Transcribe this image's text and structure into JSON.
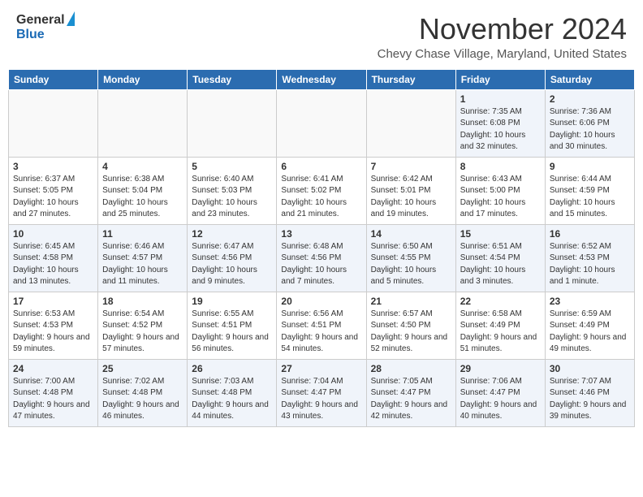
{
  "header": {
    "logo_general": "General",
    "logo_blue": "Blue",
    "month": "November 2024",
    "location": "Chevy Chase Village, Maryland, United States"
  },
  "weekdays": [
    "Sunday",
    "Monday",
    "Tuesday",
    "Wednesday",
    "Thursday",
    "Friday",
    "Saturday"
  ],
  "weeks": [
    [
      {
        "day": null
      },
      {
        "day": null
      },
      {
        "day": null
      },
      {
        "day": null
      },
      {
        "day": null
      },
      {
        "day": "1",
        "sunrise": "Sunrise: 7:35 AM",
        "sunset": "Sunset: 6:08 PM",
        "daylight": "Daylight: 10 hours and 32 minutes."
      },
      {
        "day": "2",
        "sunrise": "Sunrise: 7:36 AM",
        "sunset": "Sunset: 6:06 PM",
        "daylight": "Daylight: 10 hours and 30 minutes."
      }
    ],
    [
      {
        "day": "3",
        "sunrise": "Sunrise: 6:37 AM",
        "sunset": "Sunset: 5:05 PM",
        "daylight": "Daylight: 10 hours and 27 minutes."
      },
      {
        "day": "4",
        "sunrise": "Sunrise: 6:38 AM",
        "sunset": "Sunset: 5:04 PM",
        "daylight": "Daylight: 10 hours and 25 minutes."
      },
      {
        "day": "5",
        "sunrise": "Sunrise: 6:40 AM",
        "sunset": "Sunset: 5:03 PM",
        "daylight": "Daylight: 10 hours and 23 minutes."
      },
      {
        "day": "6",
        "sunrise": "Sunrise: 6:41 AM",
        "sunset": "Sunset: 5:02 PM",
        "daylight": "Daylight: 10 hours and 21 minutes."
      },
      {
        "day": "7",
        "sunrise": "Sunrise: 6:42 AM",
        "sunset": "Sunset: 5:01 PM",
        "daylight": "Daylight: 10 hours and 19 minutes."
      },
      {
        "day": "8",
        "sunrise": "Sunrise: 6:43 AM",
        "sunset": "Sunset: 5:00 PM",
        "daylight": "Daylight: 10 hours and 17 minutes."
      },
      {
        "day": "9",
        "sunrise": "Sunrise: 6:44 AM",
        "sunset": "Sunset: 4:59 PM",
        "daylight": "Daylight: 10 hours and 15 minutes."
      }
    ],
    [
      {
        "day": "10",
        "sunrise": "Sunrise: 6:45 AM",
        "sunset": "Sunset: 4:58 PM",
        "daylight": "Daylight: 10 hours and 13 minutes."
      },
      {
        "day": "11",
        "sunrise": "Sunrise: 6:46 AM",
        "sunset": "Sunset: 4:57 PM",
        "daylight": "Daylight: 10 hours and 11 minutes."
      },
      {
        "day": "12",
        "sunrise": "Sunrise: 6:47 AM",
        "sunset": "Sunset: 4:56 PM",
        "daylight": "Daylight: 10 hours and 9 minutes."
      },
      {
        "day": "13",
        "sunrise": "Sunrise: 6:48 AM",
        "sunset": "Sunset: 4:56 PM",
        "daylight": "Daylight: 10 hours and 7 minutes."
      },
      {
        "day": "14",
        "sunrise": "Sunrise: 6:50 AM",
        "sunset": "Sunset: 4:55 PM",
        "daylight": "Daylight: 10 hours and 5 minutes."
      },
      {
        "day": "15",
        "sunrise": "Sunrise: 6:51 AM",
        "sunset": "Sunset: 4:54 PM",
        "daylight": "Daylight: 10 hours and 3 minutes."
      },
      {
        "day": "16",
        "sunrise": "Sunrise: 6:52 AM",
        "sunset": "Sunset: 4:53 PM",
        "daylight": "Daylight: 10 hours and 1 minute."
      }
    ],
    [
      {
        "day": "17",
        "sunrise": "Sunrise: 6:53 AM",
        "sunset": "Sunset: 4:53 PM",
        "daylight": "Daylight: 9 hours and 59 minutes."
      },
      {
        "day": "18",
        "sunrise": "Sunrise: 6:54 AM",
        "sunset": "Sunset: 4:52 PM",
        "daylight": "Daylight: 9 hours and 57 minutes."
      },
      {
        "day": "19",
        "sunrise": "Sunrise: 6:55 AM",
        "sunset": "Sunset: 4:51 PM",
        "daylight": "Daylight: 9 hours and 56 minutes."
      },
      {
        "day": "20",
        "sunrise": "Sunrise: 6:56 AM",
        "sunset": "Sunset: 4:51 PM",
        "daylight": "Daylight: 9 hours and 54 minutes."
      },
      {
        "day": "21",
        "sunrise": "Sunrise: 6:57 AM",
        "sunset": "Sunset: 4:50 PM",
        "daylight": "Daylight: 9 hours and 52 minutes."
      },
      {
        "day": "22",
        "sunrise": "Sunrise: 6:58 AM",
        "sunset": "Sunset: 4:49 PM",
        "daylight": "Daylight: 9 hours and 51 minutes."
      },
      {
        "day": "23",
        "sunrise": "Sunrise: 6:59 AM",
        "sunset": "Sunset: 4:49 PM",
        "daylight": "Daylight: 9 hours and 49 minutes."
      }
    ],
    [
      {
        "day": "24",
        "sunrise": "Sunrise: 7:00 AM",
        "sunset": "Sunset: 4:48 PM",
        "daylight": "Daylight: 9 hours and 47 minutes."
      },
      {
        "day": "25",
        "sunrise": "Sunrise: 7:02 AM",
        "sunset": "Sunset: 4:48 PM",
        "daylight": "Daylight: 9 hours and 46 minutes."
      },
      {
        "day": "26",
        "sunrise": "Sunrise: 7:03 AM",
        "sunset": "Sunset: 4:48 PM",
        "daylight": "Daylight: 9 hours and 44 minutes."
      },
      {
        "day": "27",
        "sunrise": "Sunrise: 7:04 AM",
        "sunset": "Sunset: 4:47 PM",
        "daylight": "Daylight: 9 hours and 43 minutes."
      },
      {
        "day": "28",
        "sunrise": "Sunrise: 7:05 AM",
        "sunset": "Sunset: 4:47 PM",
        "daylight": "Daylight: 9 hours and 42 minutes."
      },
      {
        "day": "29",
        "sunrise": "Sunrise: 7:06 AM",
        "sunset": "Sunset: 4:47 PM",
        "daylight": "Daylight: 9 hours and 40 minutes."
      },
      {
        "day": "30",
        "sunrise": "Sunrise: 7:07 AM",
        "sunset": "Sunset: 4:46 PM",
        "daylight": "Daylight: 9 hours and 39 minutes."
      }
    ]
  ]
}
